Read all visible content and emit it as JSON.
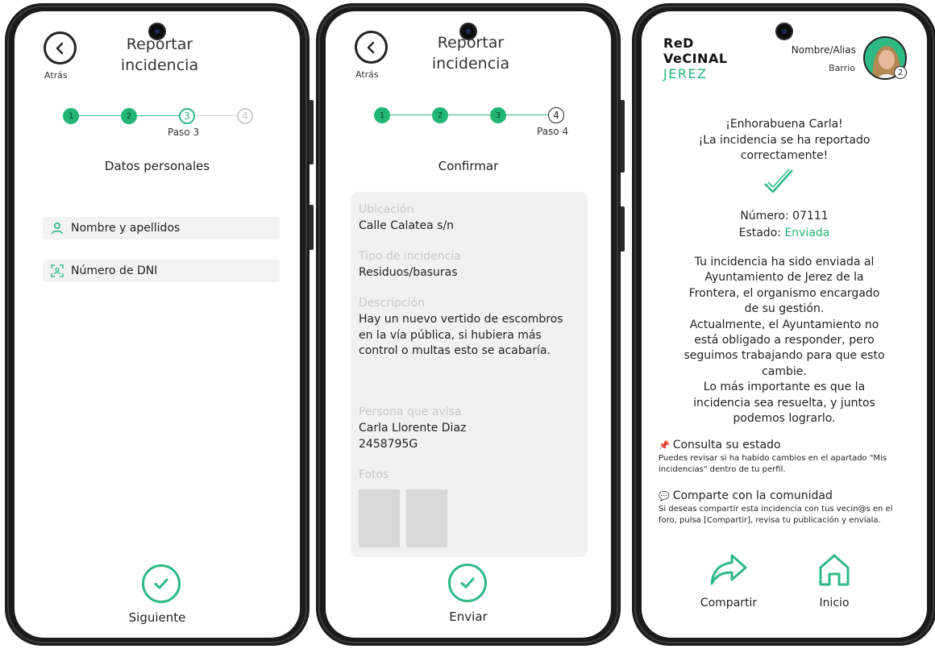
{
  "colors": {
    "accent": "#22b574",
    "accent_light": "#2fb985",
    "field_bg": "#f2f2f2",
    "summary_bg": "#f1f1f1"
  },
  "screen1": {
    "back_label": "Atrás",
    "title_line1": "Reportar",
    "title_line2": "incidencia",
    "steps": [
      "1",
      "2",
      "3",
      "4"
    ],
    "step_caption": "Paso 3",
    "section_heading": "Datos personales",
    "name_field_placeholder": "Nombre y apellidos",
    "dni_field_placeholder": "Número de DNI",
    "next_label": "Siguiente"
  },
  "screen2": {
    "back_label": "Atrás",
    "title_line1": "Reportar",
    "title_line2": "incidencia",
    "steps": [
      "1",
      "2",
      "3",
      "4"
    ],
    "step_caption": "Paso 4",
    "section_heading": "Confirmar",
    "location_label": "Ubicación",
    "location_value": "Calle Calatea  s/n",
    "type_label": "Tipo de incidencia",
    "type_value": "Residuos/basuras",
    "description_label": "Descripción",
    "description_value": "Hay un nuevo vertido de escombros en la vía pública, si hubiera más control o multas esto se acabaría.",
    "reporter_label": "Persona que avisa",
    "reporter_name": "Carla Llorente Diaz",
    "reporter_dni": "2458795G",
    "photos_label": "Fotos",
    "send_label": "Enviar"
  },
  "screen3": {
    "brand_line1": "ReD",
    "brand_line2": "VeCINAL",
    "brand_line3": "JEREZ",
    "user_name": "Nombre/Alias",
    "user_barrio": "Barrio",
    "avatar_badge": "2",
    "congrats_line1": "¡Enhorabuena Carla!",
    "congrats_line2": "¡La incidencia se ha reportado",
    "congrats_line3": "correctamente!",
    "number_label": "Número: 07111",
    "status_label": "Estado:",
    "status_value": "Enviada",
    "body_line1": "Tu incidencia ha sido enviada al",
    "body_line2": "Ayuntamiento de Jerez de la",
    "body_line3": "Frontera, el organismo encargado",
    "body_line4": "de su gestión.",
    "body_line5": "Actualmente, el Ayuntamiento no",
    "body_line6": "está obligado a responder, pero",
    "body_line7": "seguimos trabajando para que esto",
    "body_line8": "cambie.",
    "body_line9": "Lo más importante es que la",
    "body_line10": "incidencia sea resuelta, y juntos",
    "body_line11": "podemos lograrlo.",
    "tip1_icon": "📌",
    "tip1_title": "Consulta su estado",
    "tip1_text": "Puedes revisar si ha habido cambios en el apartado \"Mis incidencias\" dentro de tu perfil.",
    "tip2_icon": "💬",
    "tip2_title": "Comparte con la comunidad",
    "tip2_text": "Si deseas compartir esta incidencia con tus vecin@s en el foro, pulsa [Compartir], revisa tu publicación y envíala.",
    "share_label": "Compartir",
    "home_label": "Inicio"
  }
}
